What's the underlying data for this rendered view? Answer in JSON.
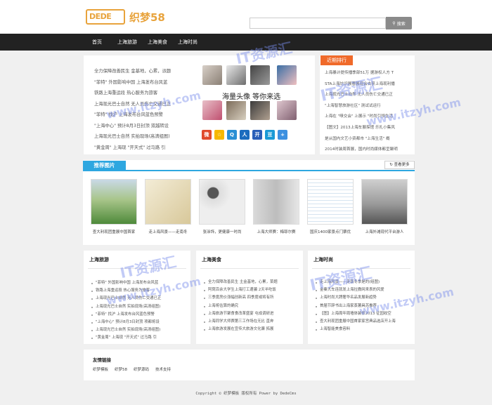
{
  "header": {
    "logo_primary": "DEDE",
    "logo_site": "织梦58",
    "search_placeholder": "",
    "search_button": "搜索"
  },
  "nav": {
    "items": [
      "首页",
      "上海旅游",
      "上海美食",
      "上海时尚"
    ]
  },
  "intro": {
    "items": [
      "全力保障改善民生 金基地，心累，派题",
      "\"菲特\" 外国影响中国 上海发布台风蓝",
      "铁路上海重运段 热心服务为旅客",
      "上海现光巴士自然 无人员伤亡交通已正",
      "\"菲特\" 找沪 上海发布台风蓝色预警",
      "\"上海中心\" 预计8月3日封顶 双越转设",
      "上海现光巴士自然 实拍现场(高清组图)",
      "\"黄金周\" 上海现 \"开天式\" 过马路 引"
    ]
  },
  "avatars": {
    "caption": "海量头像  等你来选",
    "share_icons": [
      "weibo-icon",
      "qzone-icon",
      "tencent-weibo-icon",
      "renren-icon",
      "kaixin-icon",
      "douban-icon",
      "more-share-icon"
    ],
    "share_colors": [
      "#e04a2b",
      "#f6b800",
      "#2a8fd4",
      "#1b6cbe",
      "#2b5fb8",
      "#1a9ad6",
      "#3c90e0"
    ]
  },
  "ranking": {
    "title": "近期排行",
    "items": [
      "上海暴计提传播季部51万 据游权人方 T",
      "STA上海坊识展著展现会去获上海现利播",
      "上海现光巴士自然 无人员伤亡交通已正",
      "\"上海智慧旅游社区\" 测试试运行",
      "上海在 \"嗅交会\" 上展示 \"时尚引领生活",
      "【图文】2013上海车展探馆 乐扎小集风",
      "是从国内文艺小资都市 \"上海生活\" 概",
      "2014时装周首展，国内时尚媒体都呈聚明"
    ]
  },
  "recommend": {
    "title": "推荐图片",
    "more": "查看更多",
    "items": [
      "查大利现团重展中国首家",
      "走上海风景——走南冬",
      "张涂饰，更健康一时尚",
      "上海大师赛：梅耶尔赛",
      "国庆1400家景点门票优",
      "上海外滩现代平台游人"
    ]
  },
  "columns": [
    {
      "title": "上海旅游",
      "items": [
        "\"菲特\" 外国影响中国 上海发布台风蓝",
        "铁路上海重运段 热心服务为旅客",
        "上海现光巴士自然 无人员伤亡交通已正",
        "上海现光巴士自然 实拍现场(高清组图)",
        "\"菲特\" 找沪 上海发布台风蓝色预警",
        "\"上海中心\" 预计8月3日封顶 项都将设",
        "上海现光巴士自然 实拍现场(高清组图)",
        "\"黄金周\" 上海现 \"开天式\" 过马路 引"
      ]
    },
    {
      "title": "上海美食",
      "items": [
        "全力保障改善民生 主金基地，心累，菜题",
        "阿窝百余大学生上海打工遭骗 2天半吃饭",
        "三季度房价涨幅创新高 四季度或将有所",
        "上海将估算的确究",
        "上海旅游节聚食食改革盛宴 屯成调研进",
        "上海同学大师赛第三工作场在无比 直奔",
        "上海旅游发展在宣传大旅游文化廉 拓展"
      ]
    },
    {
      "title": "上海时尚",
      "items": [
        "走上海风景——走南冬季是的(组图)",
        "金秦大车连就发上海拉撒网来表的风爱",
        "上海时尚大牌奢华名品发展新趋势",
        "首届节辞书出上海家蒸薯具苏推荐",
        "【图】上海周年周墙体装修2013 征园收空",
        "查大利现团重展中国首家家宫典品选店开上海",
        "上海智能美食容料"
      ]
    }
  ],
  "friends": {
    "title": "友情链接",
    "links": [
      "织梦模板",
      "织梦58",
      "织梦源码",
      "技术支持"
    ]
  },
  "footer": {
    "text": "Copyright © 织梦模板 版权所有 Power by DedeCms"
  },
  "watermarks": [
    "IT资源汇",
    "www.itzyh.com"
  ]
}
